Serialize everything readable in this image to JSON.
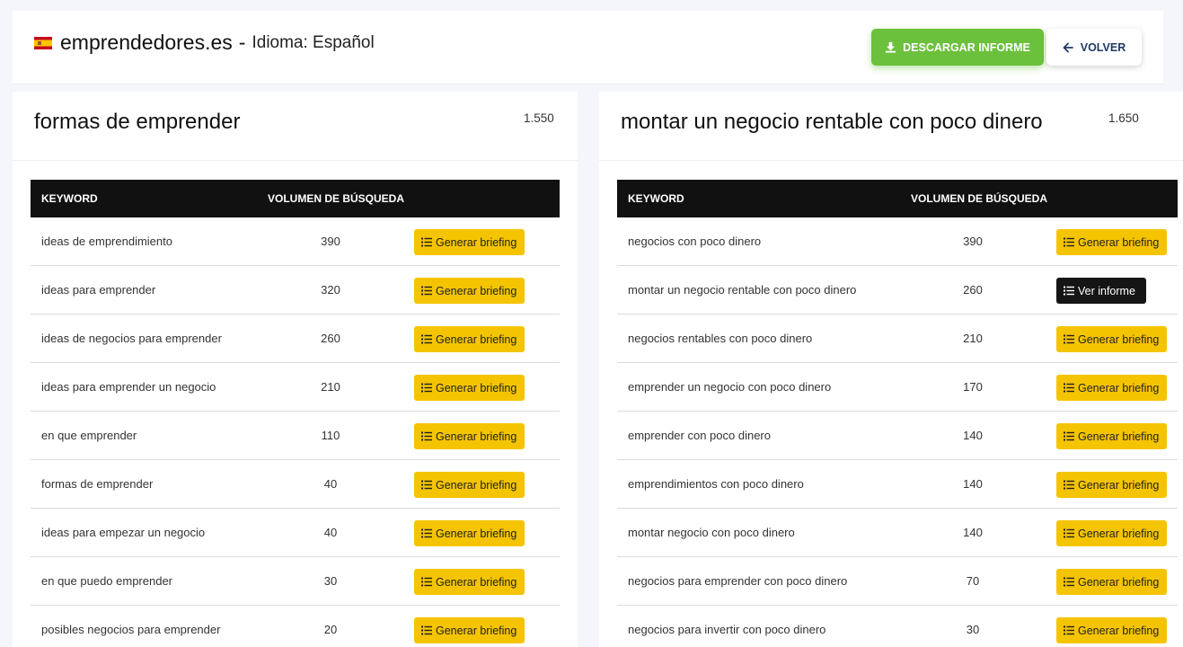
{
  "header": {
    "domain": "emprendedores.es",
    "separator": "-",
    "language": "Idioma: Español",
    "download_label": "DESCARGAR INFORME",
    "back_label": "VOLVER",
    "accent_green": "#6cc13c"
  },
  "table_headers": {
    "keyword": "KEYWORD",
    "volume": "VOLUMEN DE BÚSQUEDA"
  },
  "panels": [
    {
      "title": "formas de emprender",
      "volume": "1.550",
      "rows": [
        {
          "keyword": "ideas de emprendimiento",
          "volume": "390",
          "action": "Generar briefing"
        },
        {
          "keyword": "ideas para emprender",
          "volume": "320",
          "action": "Generar briefing"
        },
        {
          "keyword": "ideas de negocios para emprender",
          "volume": "260",
          "action": "Generar briefing"
        },
        {
          "keyword": "ideas para emprender un negocio",
          "volume": "210",
          "action": "Generar briefing"
        },
        {
          "keyword": "en que emprender",
          "volume": "110",
          "action": "Generar briefing"
        },
        {
          "keyword": "formas de emprender",
          "volume": "40",
          "action": "Generar briefing"
        },
        {
          "keyword": "ideas para empezar un negocio",
          "volume": "40",
          "action": "Generar briefing"
        },
        {
          "keyword": "en que puedo emprender",
          "volume": "30",
          "action": "Generar briefing"
        },
        {
          "keyword": "posibles negocios para emprender",
          "volume": "20",
          "action": "Generar briefing"
        }
      ]
    },
    {
      "title": "montar un negocio rentable con poco dinero",
      "volume": "1.650",
      "rows": [
        {
          "keyword": "negocios con poco dinero",
          "volume": "390",
          "action": "Generar briefing"
        },
        {
          "keyword": "montar un negocio rentable con poco dinero",
          "volume": "260",
          "action": "Ver informe"
        },
        {
          "keyword": "negocios rentables con poco dinero",
          "volume": "210",
          "action": "Generar briefing"
        },
        {
          "keyword": "emprender un negocio con poco dinero",
          "volume": "170",
          "action": "Generar briefing"
        },
        {
          "keyword": "emprender con poco dinero",
          "volume": "140",
          "action": "Generar briefing"
        },
        {
          "keyword": "emprendimientos con poco dinero",
          "volume": "140",
          "action": "Generar briefing"
        },
        {
          "keyword": "montar negocio con poco dinero",
          "volume": "140",
          "action": "Generar briefing"
        },
        {
          "keyword": "negocios para emprender con poco dinero",
          "volume": "70",
          "action": "Generar briefing"
        },
        {
          "keyword": "negocios para invertir con poco dinero",
          "volume": "30",
          "action": "Generar briefing"
        }
      ]
    }
  ],
  "icons": {
    "flag": "spain-flag-icon",
    "download": "download-icon",
    "back": "arrow-left-icon",
    "list": "list-icon"
  },
  "colors": {
    "briefing_button": "#f5c400",
    "report_button": "#151515",
    "table_header": "#111111"
  }
}
